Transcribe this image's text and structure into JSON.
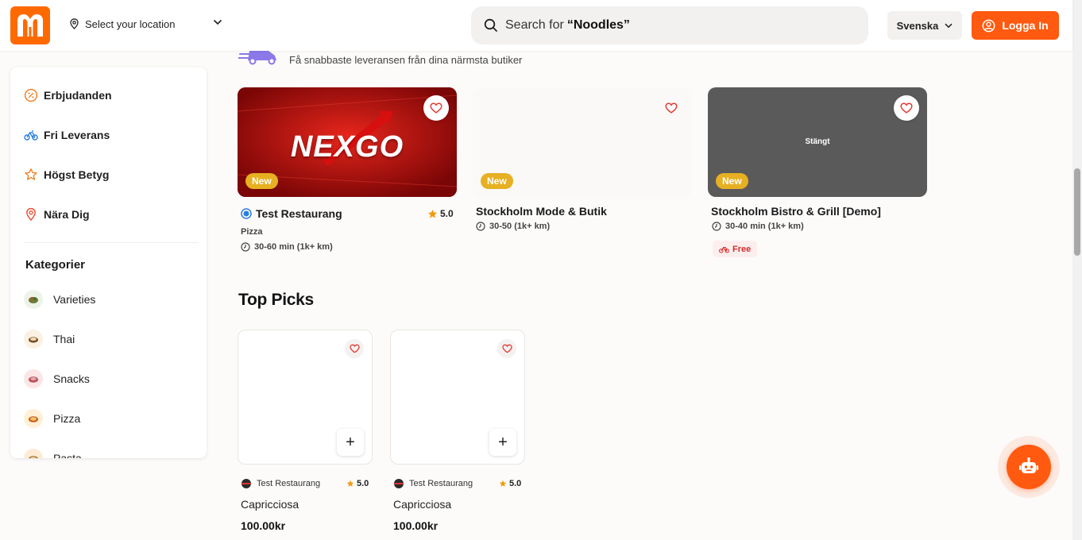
{
  "header": {
    "location_label": "Select your location",
    "search_prefix": "Search for",
    "search_term": "“Noodles”",
    "language": "Svenska",
    "login_label": "Logga In"
  },
  "sidebar": {
    "nav": [
      {
        "label": "Erbjudanden",
        "icon": "discount-icon"
      },
      {
        "label": "Fri Leverans",
        "icon": "bicycle-icon"
      },
      {
        "label": "Högst Betyg",
        "icon": "star-icon"
      },
      {
        "label": "Nära Dig",
        "icon": "location-pin-icon"
      }
    ],
    "categories_title": "Kategorier",
    "categories": [
      {
        "label": "Varieties"
      },
      {
        "label": "Thai"
      },
      {
        "label": "Snacks"
      },
      {
        "label": "Pizza"
      },
      {
        "label": "Pasta"
      }
    ]
  },
  "banner": {
    "text": "Få snabbaste leveransen från dina närmsta butiker"
  },
  "restaurants": [
    {
      "name": "Test Restaurang",
      "logo_text": "NEXGO",
      "badge": "New",
      "rating": "5.0",
      "category": "Pizza",
      "time": "30-60 min (1k+ km)"
    },
    {
      "name": "Stockholm Mode & Butik",
      "badge": "New",
      "time": "30-50 (1k+ km)"
    },
    {
      "name": "Stockholm Bistro & Grill [Demo]",
      "badge": "New",
      "status": "Stängt",
      "time": "30-40 min (1k+ km)",
      "delivery": "Free"
    }
  ],
  "top_picks": {
    "title": "Top Picks",
    "items": [
      {
        "restaurant": "Test Restaurang",
        "rating": "5.0",
        "name": "Capricciosa",
        "price": "100.00kr"
      },
      {
        "restaurant": "Test Restaurang",
        "rating": "5.0",
        "name": "Capricciosa",
        "price": "100.00kr"
      }
    ]
  },
  "colors": {
    "brand": "#ff5a0f",
    "badge_new": "#e6b022",
    "free_text": "#d52b2b",
    "closed_overlay": "#5a5a5a"
  }
}
